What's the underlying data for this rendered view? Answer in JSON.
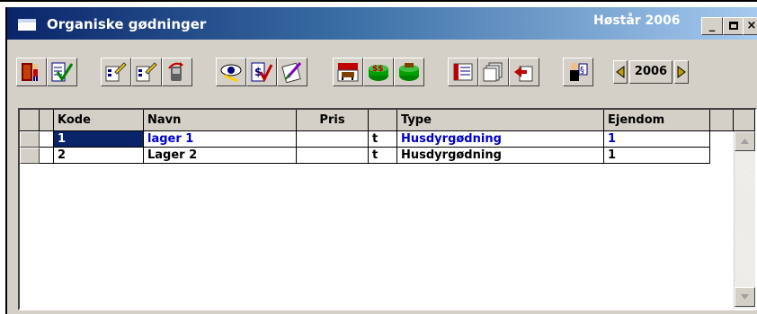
{
  "window": {
    "title": "Organiske gødninger",
    "season": "Høstår 2006",
    "controls": {
      "minimize": "_",
      "close": "×"
    }
  },
  "toolbar": {
    "buttons": [
      {
        "name": "exit-door-icon"
      },
      {
        "name": "approve-check-icon"
      },
      {
        "name": "edit-form-icon"
      },
      {
        "name": "edit-form-2-icon"
      },
      {
        "name": "undo-mobile-icon"
      },
      {
        "name": "view-eye-icon"
      },
      {
        "name": "price-check-icon"
      },
      {
        "name": "edit-list-icon"
      },
      {
        "name": "livestock-cow-icon"
      },
      {
        "name": "manure-money-icon"
      },
      {
        "name": "manure-tank-icon"
      },
      {
        "name": "table-view-icon"
      },
      {
        "name": "pages-icon"
      },
      {
        "name": "transfer-icon"
      },
      {
        "name": "law-paragraph-icon"
      }
    ],
    "year": "2006"
  },
  "grid": {
    "columns": [
      "Kode",
      "Navn",
      "Pris",
      "",
      "Type",
      "Ejendom"
    ],
    "rows": [
      {
        "kode": "1",
        "navn": "lager 1",
        "pris": "",
        "unit": "t",
        "type": "Husdyrgødning",
        "ejendom": "1"
      },
      {
        "kode": "2",
        "navn": "Lager 2",
        "pris": "",
        "unit": "t",
        "type": "Husdyrgødning",
        "ejendom": "1"
      }
    ]
  }
}
